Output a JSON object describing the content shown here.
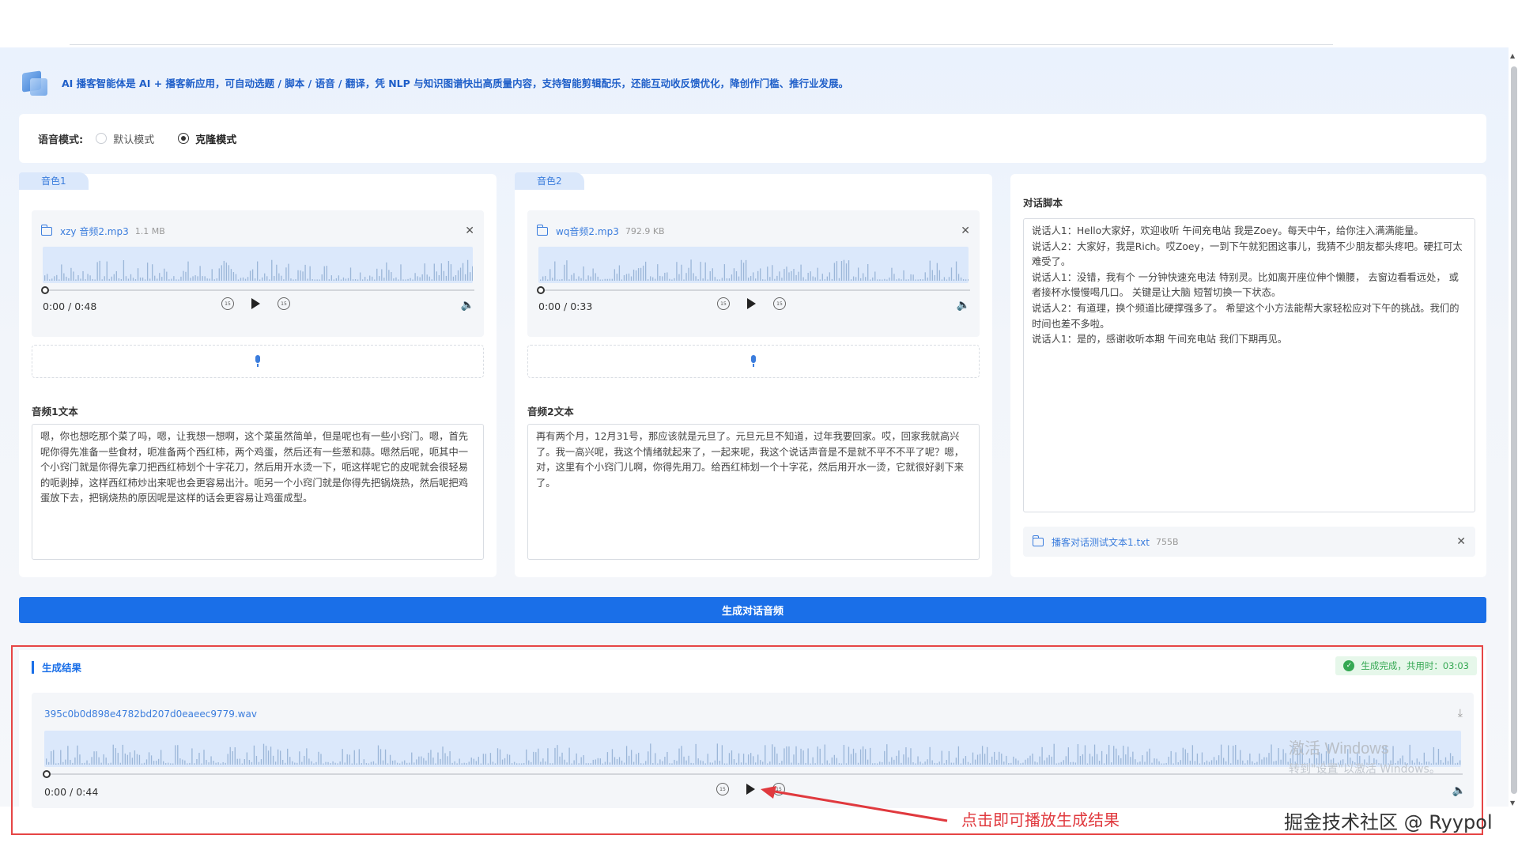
{
  "intro": {
    "text": "AI 播客智能体是 AI + 播客新应用，可自动选题 / 脚本 / 语音 / 翻译，凭 NLP 与知识图谱快出高质量内容，支持智能剪辑配乐，还能互动收反馈优化，降创作门槛、推行业发展。"
  },
  "mode": {
    "label": "语音模式:",
    "options": [
      "默认模式",
      "克隆模式"
    ],
    "selected": "克隆模式"
  },
  "voice1": {
    "tag": "音色1",
    "file_name": "xzy 音频2.mp3",
    "file_size": "1.1 MB",
    "time": "0:00 / 0:48",
    "text_label": "音频1文本",
    "text": "嗯，你也想吃那个菜了吗，嗯，让我想一想啊，这个菜虽然简单，但是呢也有一些小窍门。嗯，首先呢你得先准备一些食材，呃准备两个西红柿，两个鸡蛋，然后还有一些葱和蒜。嗯然后呢，呃其中一个小窍门就是你得先拿刀把西红柿划个十字花刀，然后用开水烫一下，呃这样呢它的皮呢就会很轻易的呃剥掉，这样西红柿炒出来呢也会更容易出汁。呃另一个小窍门就是你得先把锅烧热，然后呢把鸡蛋放下去，把锅烧热的原因呢是这样的话会更容易让鸡蛋成型。"
  },
  "voice2": {
    "tag": "音色2",
    "file_name": "wq音频2.mp3",
    "file_size": "792.9 KB",
    "time": "0:00 / 0:33",
    "text_label": "音频2文本",
    "text": "再有两个月，12月31号，那应该就是元旦了。元旦元旦不知道，过年我要回家。哎，回家我就高兴了。我一高兴呢，我这个情绪就起来了，一起来呢，我这个说话声音是不是就不平不不平了呢？嗯，对，这里有个小窍门儿啊，你得先用刀。给西红柿划一个十字花，然后用开水一烫，它就很好剥下来了。"
  },
  "script": {
    "label": "对话脚本",
    "lines": [
      "说话人1：Hello大家好，欢迎收听 午间充电站 我是Zoey。每天中午，给你注入满满能量。",
      "说话人2：大家好，我是Rich。哎Zoey，一到下午就犯困这事儿，我猜不少朋友都头疼吧。硬扛可太难受了。",
      "说话人1：没错，我有个 一分钟快速充电法 特别灵。比如离开座位伸个懒腰， 去窗边看看远处， 或者接杯水慢慢喝几口。 关键是让大脑 短暂切换一下状态。",
      "说话人2：有道理，换个频道比硬撑强多了。 希望这个小方法能帮大家轻松应对下午的挑战。我们的时间也差不多啦。",
      "说话人1：是的，感谢收听本期 午间充电站    我们下期再见。"
    ],
    "file_name": "播客对话测试文本1.txt",
    "file_size": "755B"
  },
  "generate_button": "生成对话音频",
  "result": {
    "title": "生成结果",
    "status": "生成完成，共用时：03:03",
    "file_name": "395c0b0d898e4782bd207d0eaeec9779.wav",
    "time": "0:00 / 0:44"
  },
  "overlays": {
    "windows_watermark_1": "激活 Windows",
    "windows_watermark_2": "转到\"设置\"以激活 Windows。",
    "annotation": "点击即可播放生成结果",
    "credit": "掘金技术社区 @ Ryypol"
  },
  "colors": {
    "accent": "#1a6fe8",
    "link": "#3b7ddd",
    "success": "#35a853",
    "annotation": "#e0393e"
  }
}
